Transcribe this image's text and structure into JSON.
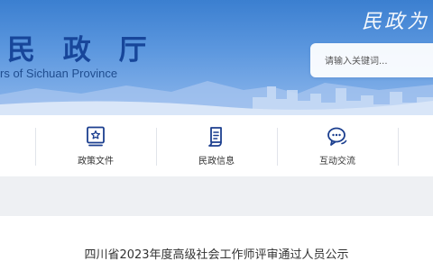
{
  "header": {
    "title": "民 政 厅",
    "subtitle": "rs of Sichuan Province",
    "slogan": "民政为",
    "search_placeholder": "请输入关键词..."
  },
  "nav": {
    "items": [
      {
        "label": "政策文件",
        "icon": "policy-document-icon"
      },
      {
        "label": "民政信息",
        "icon": "info-document-icon"
      },
      {
        "label": "互动交流",
        "icon": "chat-bubbles-icon"
      }
    ]
  },
  "article": {
    "title": "四川省2023年度高级社会工作师评审通过人员公示"
  },
  "colors": {
    "brand_blue": "#17469a",
    "header_top": "#3b7fd0",
    "icon_blue": "#1c3f8f",
    "band_gray": "#eef0f3"
  }
}
